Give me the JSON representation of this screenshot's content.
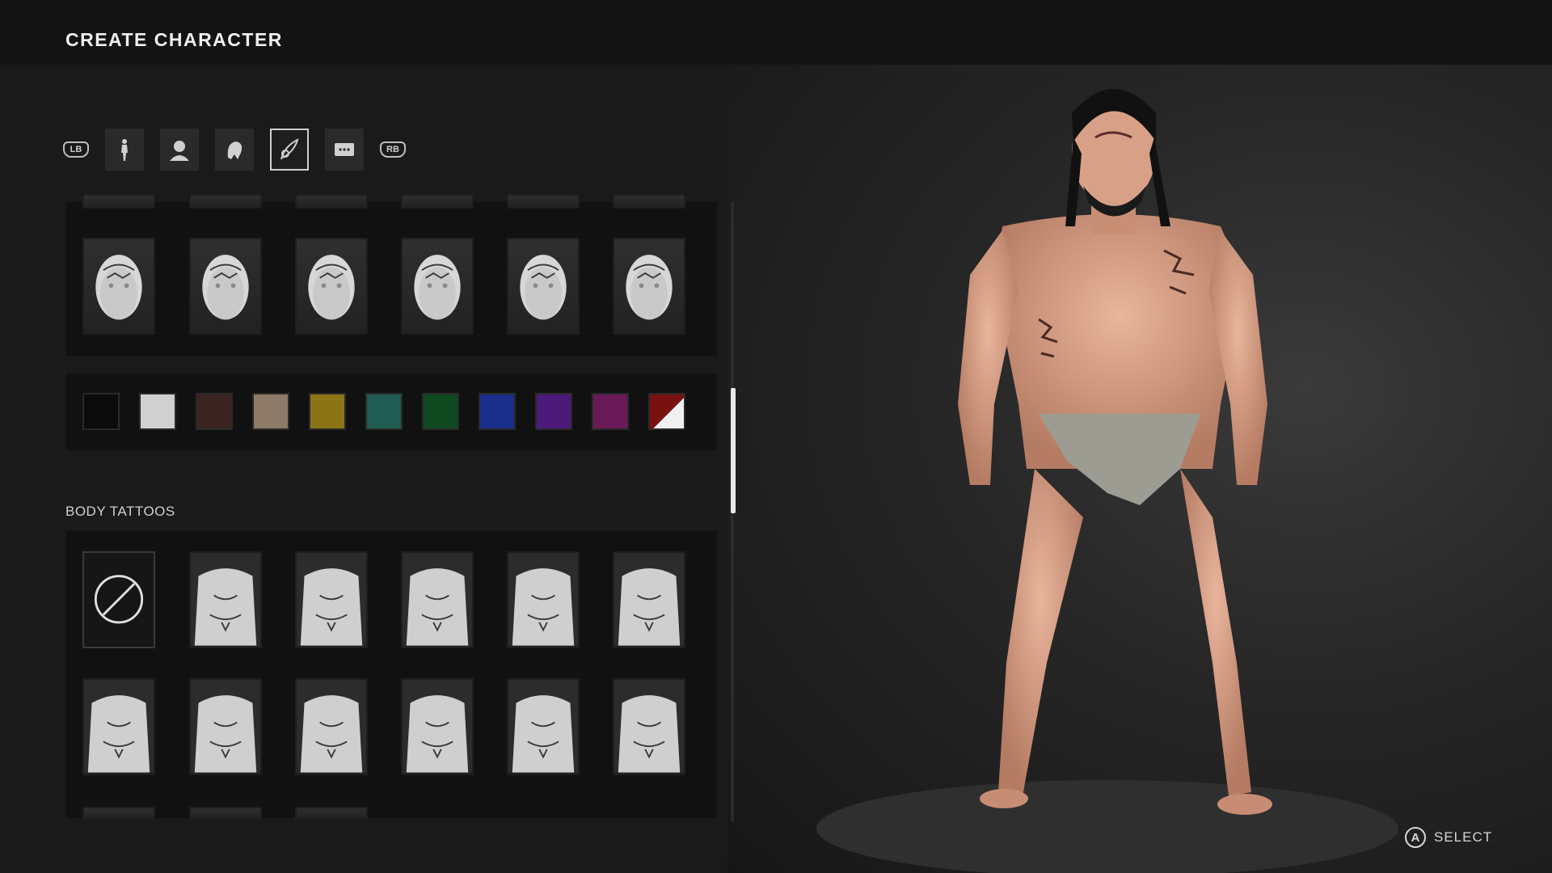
{
  "header": {
    "title": "CREATE CHARACTER"
  },
  "category_bar": {
    "left_bumper": "LB",
    "right_bumper": "RB",
    "tabs": [
      {
        "icon": "body-icon",
        "active": false
      },
      {
        "icon": "head-icon",
        "active": false
      },
      {
        "icon": "hair-icon",
        "active": false
      },
      {
        "icon": "tattoo-quill-icon",
        "active": true
      },
      {
        "icon": "speech-bubble-icon",
        "active": false
      }
    ]
  },
  "face_tattoos": {
    "thumbnails": [
      "face-tattoo-1",
      "face-tattoo-2",
      "face-tattoo-3",
      "face-tattoo-4",
      "face-tattoo-5",
      "face-tattoo-6"
    ]
  },
  "tattoo_colors": [
    "#0b0b0b",
    "#d0d0d0",
    "#3b2420",
    "#8d7b68",
    "#8a7416",
    "#1f5c51",
    "#0f4a20",
    "#1a2e8c",
    "#4c1a7a",
    "#6a1a58",
    "#7a1111"
  ],
  "body_tattoos": {
    "label": "BODY TATTOOS",
    "rows": [
      [
        "none",
        "body-tattoo-1",
        "body-tattoo-2",
        "body-tattoo-3",
        "body-tattoo-4",
        "body-tattoo-5"
      ],
      [
        "body-tattoo-6",
        "body-tattoo-7",
        "body-tattoo-8",
        "body-tattoo-9",
        "body-tattoo-10",
        "body-tattoo-11"
      ]
    ]
  },
  "prompt": {
    "button": "A",
    "label": "SELECT"
  }
}
